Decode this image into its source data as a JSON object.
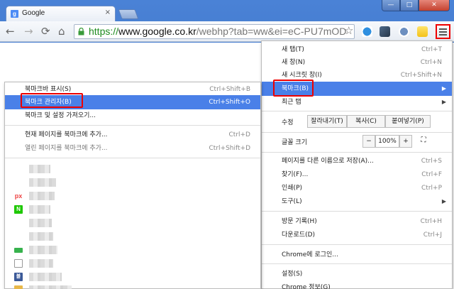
{
  "tab": {
    "title": "Google",
    "favicon": "google-g-icon",
    "favicon_letter": "g",
    "close": "×"
  },
  "window": {
    "minimize": "—",
    "maximize": "□",
    "close": "✕"
  },
  "toolbar": {
    "back": "←",
    "forward": "→",
    "reload": "⟳",
    "home": "⌂",
    "url_scheme": "https://",
    "url_host": "www.google.co.kr",
    "url_path": "/webhp?tab=ww&ei=eC-PU7mOD",
    "star": "☆"
  },
  "main_menu": {
    "items": [
      {
        "label": "새 탭(T)",
        "shortcut": "Ctrl+T"
      },
      {
        "label": "새 창(N)",
        "shortcut": "Ctrl+N"
      },
      {
        "label": "새 시크릿 창(I)",
        "shortcut": "Ctrl+Shift+N"
      },
      {
        "label": "북마크(B)",
        "shortcut": "",
        "arrow": "▶"
      },
      {
        "label": "최근 탭",
        "shortcut": "",
        "arrow": "▶"
      },
      {
        "label": "글꼴 크기",
        "shortcut": ""
      },
      {
        "label": "페이지를 다른 이름으로 저장(A)...",
        "shortcut": "Ctrl+S"
      },
      {
        "label": "찾기(F)...",
        "shortcut": "Ctrl+F"
      },
      {
        "label": "인쇄(P)",
        "shortcut": "Ctrl+P"
      },
      {
        "label": "도구(L)",
        "shortcut": "",
        "arrow": "▶"
      },
      {
        "label": "방문 기록(H)",
        "shortcut": "Ctrl+H"
      },
      {
        "label": "다운로드(D)",
        "shortcut": "Ctrl+J"
      },
      {
        "label": "Chrome에 로그인...",
        "shortcut": ""
      },
      {
        "label": "설정(S)",
        "shortcut": ""
      },
      {
        "label": "Chrome 정보(G)",
        "shortcut": ""
      }
    ],
    "edit": {
      "label": "수정",
      "cut": "잘라내기(T)",
      "copy": "복사(C)",
      "paste": "붙여넣기(P)"
    },
    "zoom": {
      "minus": "−",
      "value": "100%",
      "plus": "+",
      "fullscreen": "⛶"
    }
  },
  "bookmark_menu": {
    "items": [
      {
        "label": "북마크바 표시(S)",
        "shortcut": "Ctrl+Shift+B"
      },
      {
        "label": "북마크 관리자(B)",
        "shortcut": "Ctrl+Shift+O"
      },
      {
        "label": "북마크 및 설정 가져오기...",
        "shortcut": ""
      },
      {
        "label": "현재 페이지를 북마크에 추가...",
        "shortcut": "Ctrl+D"
      },
      {
        "label": "열린 페이지를 북마크에 추가...",
        "shortcut": "Ctrl+Shift+D"
      }
    ],
    "bookmarks": [
      {
        "icon": "google-icon",
        "letter": "g",
        "color": "#4c8bf5"
      },
      {
        "icon": "google-icon",
        "letter": "g",
        "color": "#4c8bf5"
      },
      {
        "icon": "px-icon",
        "letter": "px",
        "color": "#ffffff"
      },
      {
        "icon": "naver-icon",
        "letter": "N",
        "color": "#1ec800"
      },
      {
        "icon": "google-icon",
        "letter": "g",
        "color": "#4c8bf5"
      },
      {
        "icon": "google-icon",
        "letter": "g",
        "color": "#4c8bf5"
      },
      {
        "icon": "green-bar-icon",
        "letter": "",
        "color": "#37b24d"
      },
      {
        "icon": "page-icon",
        "letter": "",
        "color": "#ffffff"
      },
      {
        "icon": "blog-icon",
        "letter": "블",
        "color": "#3b5998"
      },
      {
        "icon": "folder-icon",
        "letter": "",
        "color": "#e8b84a"
      }
    ]
  },
  "colors": {
    "highlight": "#4a80e8",
    "annotation": "#ee0000",
    "frame": "#3c6fc4"
  }
}
